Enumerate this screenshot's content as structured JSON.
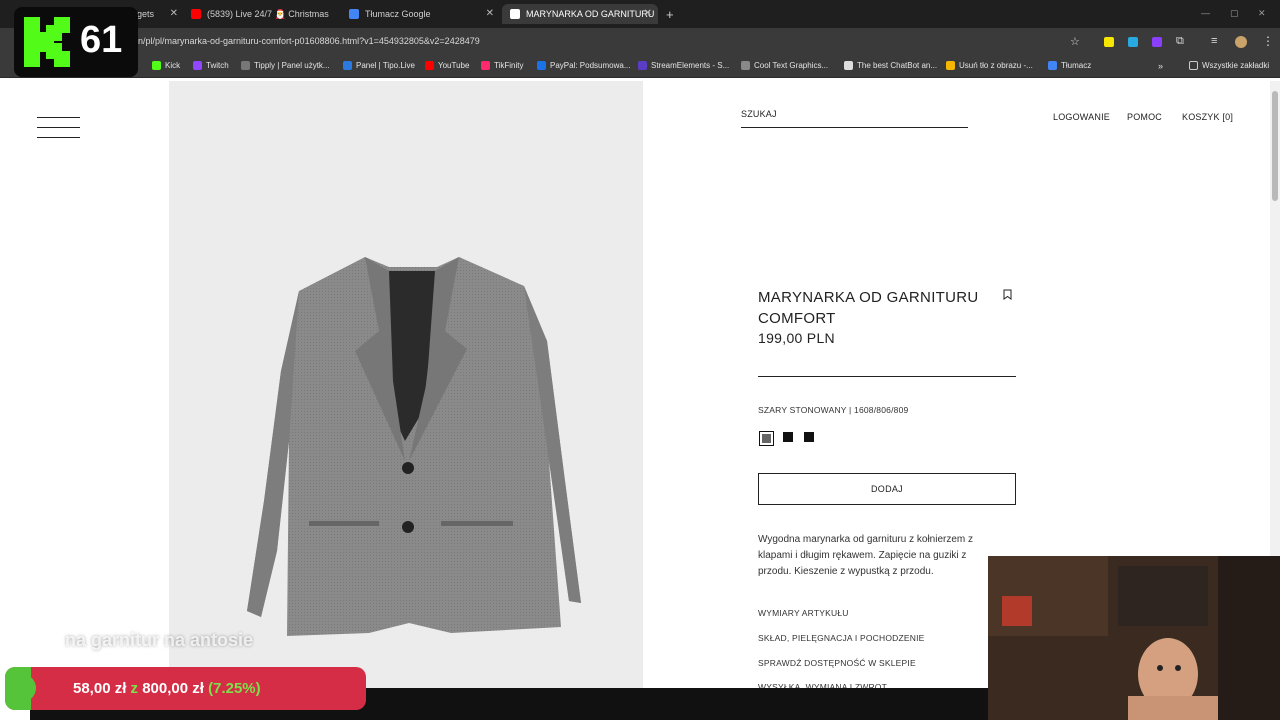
{
  "browser": {
    "tabs": [
      {
        "label": "dgets",
        "icon": "widget-icon"
      },
      {
        "label": "(5839) Live 24/7 🎅 Christmas",
        "icon": "youtube-icon"
      },
      {
        "label": "Tłumacz Google",
        "icon": "google-translate-icon"
      },
      {
        "label": "MARYNARKA OD GARNITURU",
        "icon": "zara-icon"
      }
    ],
    "new_tab": "+",
    "url": "n/pl/pl/marynarka-od-garnituru-comfort-p01608806.html?v1=454932805&v2=2428479",
    "bookmarks": [
      {
        "label": "Kick",
        "color": "#53fc18"
      },
      {
        "label": "Twitch",
        "color": "#9146ff"
      },
      {
        "label": "Tipply | Panel użytk...",
        "color": "#777777"
      },
      {
        "label": "Panel | Tipo.Live",
        "color": "#2a7ae2"
      },
      {
        "label": "YouTube",
        "color": "#ff0000"
      },
      {
        "label": "TikFinity",
        "color": "#ff2a6d"
      },
      {
        "label": "PayPal: Podsumowa...",
        "color": "#1a73e8"
      },
      {
        "label": "StreamElements - S...",
        "color": "#5b3cc4"
      },
      {
        "label": "Cool Text Graphics...",
        "color": "#888888"
      },
      {
        "label": "The best ChatBot an...",
        "color": "#dddddd"
      },
      {
        "label": "Usuń tło z obrazu -...",
        "color": "#f5b700"
      },
      {
        "label": "Tłumacz",
        "color": "#4285f4"
      }
    ],
    "all_bookmarks": "Wszystkie zakładki"
  },
  "header": {
    "search": "SZUKAJ",
    "login": "LOGOWANIE",
    "help": "POMOC",
    "cart": "KOSZYK [0]"
  },
  "product": {
    "name_line1": "MARYNARKA OD GARNITURU",
    "name_line2": "COMFORT",
    "price": "199,00 PLN",
    "color_line": "SZARY STONOWANY | 1608/806/809",
    "add_button": "DODAJ",
    "description": "Wygodna marynarka od garnituru z kołnierzem z klapami i długim rękawem. Zapięcie na guziki z przodu. Kieszenie z wypustką z przodu.",
    "info_links": [
      "WYMIARY ARTYKUŁU",
      "SKŁAD, PIELĘGNACJA I POCHODZENIE",
      "SPRAWDŹ DOSTĘPNOŚĆ W SKLEPIE",
      "WYSYŁKA, WYMIANA I ZWROT"
    ]
  },
  "overlay": {
    "channel_number": "61",
    "subtitle": "na garnitur na antosie",
    "donation_current": "58,00 zł",
    "donation_sep": "z",
    "donation_goal": "800,00 zł",
    "donation_percent": "(7.25%)",
    "donation_fraction": 0.0725
  },
  "colors": {
    "accent_green": "#56c43a",
    "goal_red": "#d42d45",
    "chrome_dark": "#1f1f1f"
  }
}
